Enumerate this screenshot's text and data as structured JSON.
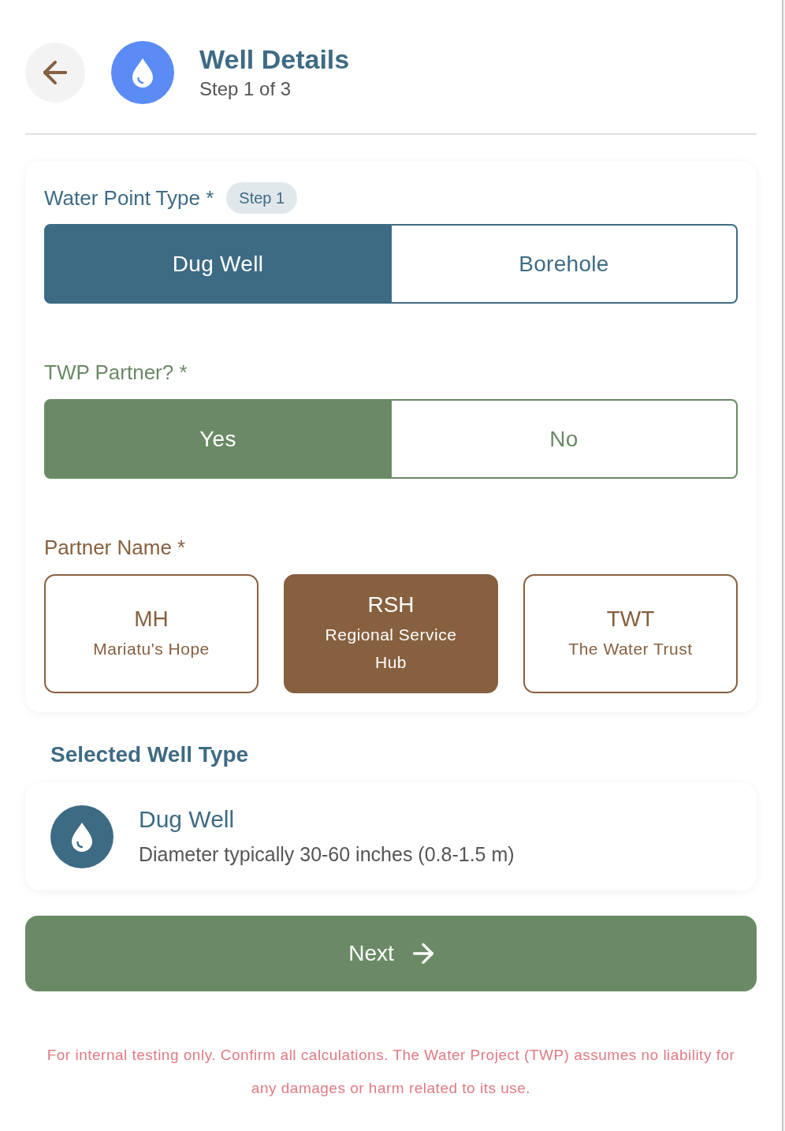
{
  "header": {
    "title": "Well Details",
    "subtitle": "Step 1 of 3"
  },
  "water_point_type": {
    "label": "Water Point Type *",
    "badge": "Step 1",
    "options": [
      {
        "label": "Dug Well",
        "selected": true
      },
      {
        "label": "Borehole",
        "selected": false
      }
    ]
  },
  "twp_partner": {
    "label": "TWP Partner? *",
    "options": [
      {
        "label": "Yes",
        "selected": true
      },
      {
        "label": "No",
        "selected": false
      }
    ]
  },
  "partner_name": {
    "label": "Partner Name *",
    "options": [
      {
        "abbreviation": "MH",
        "name": "Mariatu's Hope",
        "selected": false
      },
      {
        "abbreviation": "RSH",
        "name": "Regional Service Hub",
        "selected": true
      },
      {
        "abbreviation": "TWT",
        "name": "The Water Trust",
        "selected": false
      }
    ]
  },
  "selected_well_type": {
    "heading": "Selected Well Type",
    "name": "Dug Well",
    "description": "Diameter typically 30-60 inches (0.8-1.5 m)"
  },
  "next_button": {
    "label": "Next"
  },
  "disclaimer": "For internal testing only. Confirm all calculations. The Water Project (TWP) assumes no liability for any damages or harm related to its use."
}
